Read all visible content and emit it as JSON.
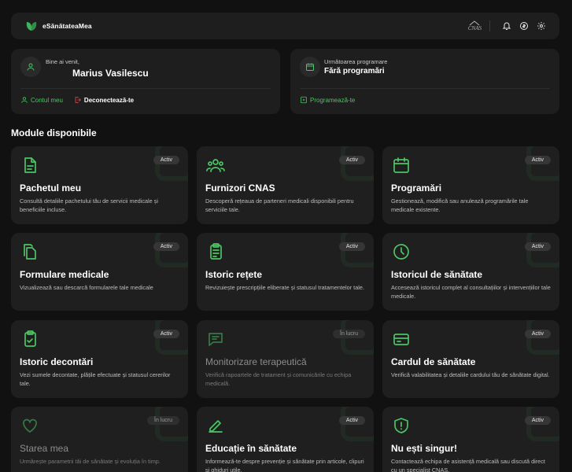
{
  "brand": {
    "name": "eSănătateaMea",
    "logo_icon": "leaf-icon",
    "partner_logo": "CNAS"
  },
  "colors": {
    "accent": "#4cc465",
    "background": "#111111",
    "card": "#1e1e1e",
    "logout": "#e04a4a"
  },
  "welcome": {
    "greeting": "Bine ai venit,",
    "name": "Marius Vasilescu",
    "account_link": "Contul meu",
    "logout_link": "Deconectează-te"
  },
  "appointment": {
    "label": "Următoarea programare",
    "value": "Fără programări",
    "schedule_link": "Programează-te"
  },
  "modules_title": "Module disponibile",
  "modules": [
    {
      "title": "Pachetul meu",
      "desc": "Consultă detaliile pachetului tău de servicii medicale și beneficiile incluse.",
      "status": "Activ",
      "icon": "document-icon"
    },
    {
      "title": "Furnizori CNAS",
      "desc": "Descoperă rețeaua de parteneri medicali disponibili pentru serviciile tale.",
      "status": "Activ",
      "icon": "users-icon"
    },
    {
      "title": "Programări",
      "desc": "Gestionează, modifică sau anulează programările tale medicale existente.",
      "status": "Activ",
      "icon": "calendar-icon"
    },
    {
      "title": "Formulare medicale",
      "desc": "Vizualizează sau descarcă formularele tale medicale",
      "status": "Activ",
      "icon": "files-icon"
    },
    {
      "title": "Istoric rețete",
      "desc": "Revizuiește prescripțiile eliberate și statusul tratamentelor tale.",
      "status": "Activ",
      "icon": "clipboard-icon"
    },
    {
      "title": "Istoricul de sănătate",
      "desc": "Accesează istoricul complet al consultațiilor și intervențiilor tale medicale.",
      "status": "Activ",
      "icon": "clock-icon"
    },
    {
      "title": "Istoric decontări",
      "desc": "Vezi sumele decontate, plățile efectuate și statusul cererilor tale.",
      "status": "Activ",
      "icon": "clipboard-check-icon"
    },
    {
      "title": "Monitorizare terapeutică",
      "desc": "Verifică rapoartele de tratament și comunicările cu echipa medicală.",
      "status": "În lucru",
      "icon": "message-icon"
    },
    {
      "title": "Cardul de sănătate",
      "desc": "Verifică valabilitatea și detaliile cardului tău de sănătate digital.",
      "status": "Activ",
      "icon": "card-icon"
    },
    {
      "title": "Starea mea",
      "desc": "Urmărește parametrii tăi de sănătate și evoluția în timp.",
      "status": "În lucru",
      "icon": "heart-icon"
    },
    {
      "title": "Educație în sănătate",
      "desc": "Informează-te despre prevenție și sănătate prin articole, clipuri și ghiduri utile.",
      "status": "Activ",
      "icon": "edit-icon"
    },
    {
      "title": "Nu ești singur!",
      "desc": "Contactează echipa de asistență medicală sau discută direct cu un specialist CNAS.",
      "status": "Activ",
      "icon": "shield-alert-icon"
    }
  ]
}
